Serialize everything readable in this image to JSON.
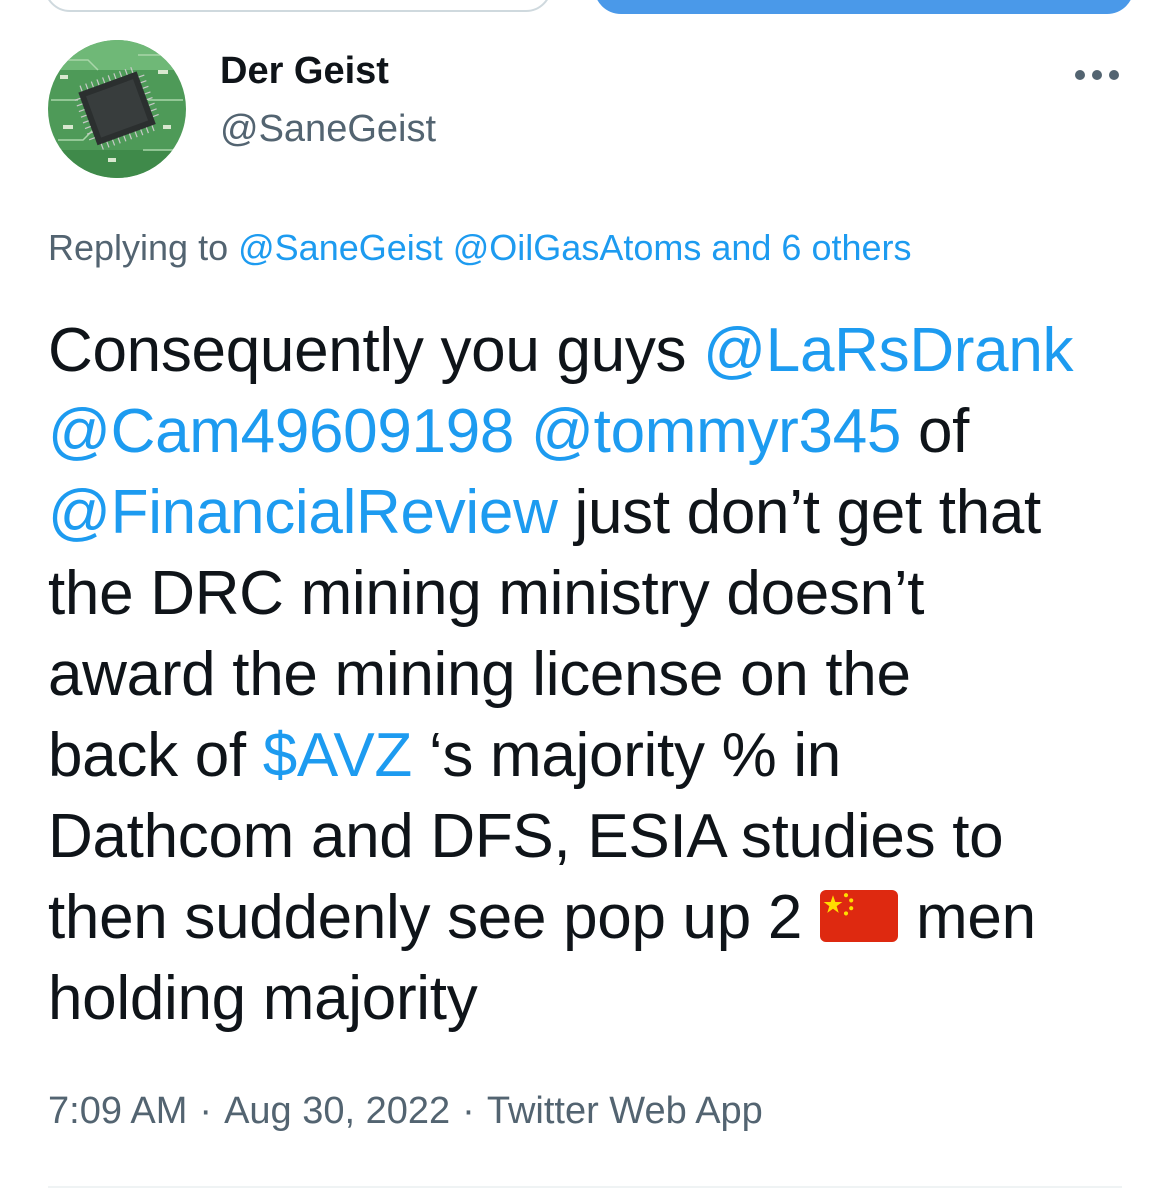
{
  "author": {
    "display_name": "Der Geist",
    "handle": "@SaneGeist"
  },
  "reply_context": {
    "prefix": "Replying to ",
    "mentions": "@SaneGeist @OilGasAtoms and 6 others"
  },
  "tweet": {
    "line1_text": "Consequently you guys ",
    "line1_link": "@LaRsDrank",
    "line2_link1": "@Cam49609198",
    "line2_space": " ",
    "line2_link2": "@tommyr345",
    "line2_text": " of",
    "line3_link": "@FinancialReview",
    "line3_text": " just don’t get that",
    "line4_text": "the DRC mining ministry doesn’t",
    "line5_text": "award the mining license on the",
    "line6_text1": "back of ",
    "line6_link": "$AVZ",
    "line6_text2": " ‘s majority % in",
    "line7_text": "Dathcom and DFS, ESIA studies to",
    "line8_text1": "then suddenly see pop up 2",
    "line8_text2": "men",
    "line9_text": "holding majority",
    "flag_icon": "china-flag-icon"
  },
  "meta": {
    "time": "7:09 AM",
    "separator": "·",
    "date": "Aug 30, 2022",
    "source": "Twitter Web App"
  },
  "colors": {
    "link": "#1d9bf0",
    "muted": "#536471",
    "text": "#0f1419",
    "button": "#4a99e9"
  }
}
